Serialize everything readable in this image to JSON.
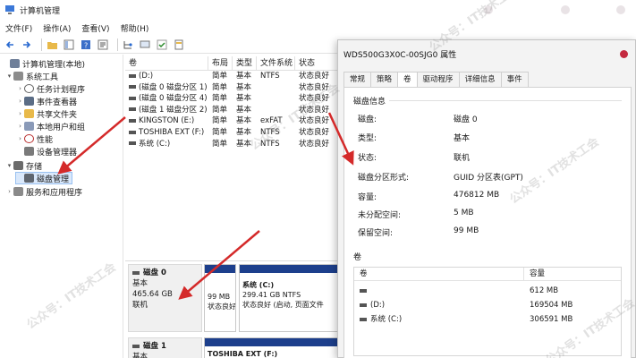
{
  "window": {
    "title": "计算机管理",
    "menus": [
      "文件(F)",
      "操作(A)",
      "查看(V)",
      "帮助(H)"
    ]
  },
  "toolbar": {
    "icons": [
      "back-icon",
      "forward-icon",
      "up-folder-icon",
      "view-icon",
      "help-icon",
      "properties-icon",
      "tree-icon",
      "connect-icon",
      "check-icon",
      "export-icon"
    ]
  },
  "tree": {
    "items": [
      {
        "label": "计算机管理(本地)",
        "icon": "computer-icon",
        "caret": ""
      },
      {
        "label": "系统工具",
        "icon": "tools-icon",
        "caret": "▾"
      },
      {
        "label": "任务计划程序",
        "icon": "clock-icon",
        "caret": "›"
      },
      {
        "label": "事件查看器",
        "icon": "event-icon",
        "caret": "›"
      },
      {
        "label": "共享文件夹",
        "icon": "folder-icon",
        "caret": "›"
      },
      {
        "label": "本地用户和组",
        "icon": "users-icon",
        "caret": "›"
      },
      {
        "label": "性能",
        "icon": "performance-icon",
        "caret": "›"
      },
      {
        "label": "设备管理器",
        "icon": "device-icon",
        "caret": ""
      },
      {
        "label": "存储",
        "icon": "storage-icon",
        "caret": "▾"
      },
      {
        "label": "磁盘管理",
        "icon": "disk-icon",
        "caret": ""
      },
      {
        "label": "服务和应用程序",
        "icon": "services-icon",
        "caret": "›"
      }
    ]
  },
  "volumes": {
    "headers": [
      "卷",
      "布局",
      "类型",
      "文件系统",
      "状态"
    ],
    "rows": [
      {
        "name": "(D:)",
        "layout": "简单",
        "type": "基本",
        "fs": "NTFS",
        "status": "状态良好"
      },
      {
        "name": "(磁盘 0 磁盘分区 1)",
        "layout": "简单",
        "type": "基本",
        "fs": "",
        "status": "状态良好"
      },
      {
        "name": "(磁盘 0 磁盘分区 4)",
        "layout": "简单",
        "type": "基本",
        "fs": "",
        "status": "状态良好"
      },
      {
        "name": "(磁盘 1 磁盘分区 2)",
        "layout": "简单",
        "type": "基本",
        "fs": "",
        "status": "状态良好"
      },
      {
        "name": "KINGSTON (E:)",
        "layout": "简单",
        "type": "基本",
        "fs": "exFAT",
        "status": "状态良好"
      },
      {
        "name": "TOSHIBA EXT (F:)",
        "layout": "简单",
        "type": "基本",
        "fs": "NTFS",
        "status": "状态良好"
      },
      {
        "name": "系统 (C:)",
        "layout": "简单",
        "type": "基本",
        "fs": "NTFS",
        "status": "状态良好"
      }
    ]
  },
  "diskmap": {
    "disk0": {
      "name": "磁盘 0",
      "type": "基本",
      "size": "465.64 GB",
      "status": "联机"
    },
    "disk0_parts": [
      {
        "title": "",
        "line1": "99 MB",
        "line2": "状态良好"
      },
      {
        "title": "系统 (C:)",
        "line1": "299.41 GB NTFS",
        "line2": "状态良好 (启动, 页面文件"
      }
    ],
    "disk1": {
      "name": "磁盘 1",
      "type": "基本"
    },
    "disk1_parts": [
      {
        "title": "TOSHIBA EXT (F:)"
      }
    ]
  },
  "dialog": {
    "title": "WDS500G3X0C-00SJG0 属性",
    "tabs": [
      "常规",
      "策略",
      "卷",
      "驱动程序",
      "详细信息",
      "事件"
    ],
    "active_tab": 2,
    "info_title": "磁盘信息",
    "info": [
      {
        "k": "磁盘:",
        "v": "磁盘 0"
      },
      {
        "k": "类型:",
        "v": "基本"
      },
      {
        "k": "状态:",
        "v": "联机"
      },
      {
        "k": "磁盘分区形式:",
        "v": "GUID 分区表(GPT)"
      },
      {
        "k": "容量:",
        "v": "476812 MB"
      },
      {
        "k": "未分配空间:",
        "v": "5 MB"
      },
      {
        "k": "保留空间:",
        "v": "99 MB"
      }
    ],
    "vol_title": "卷",
    "vol_headers": [
      "卷",
      "容量"
    ],
    "vol_rows": [
      {
        "name": "",
        "size": "612 MB"
      },
      {
        "name": "(D:)",
        "size": "169504 MB"
      },
      {
        "name": "系统 (C:)",
        "size": "306591 MB"
      }
    ]
  },
  "watermark": "公众号：IT技术工会",
  "colors": {
    "accent_red": "#d42a2a",
    "partition_bar": "#1d3f8c",
    "selection": "#d9e8fb"
  }
}
